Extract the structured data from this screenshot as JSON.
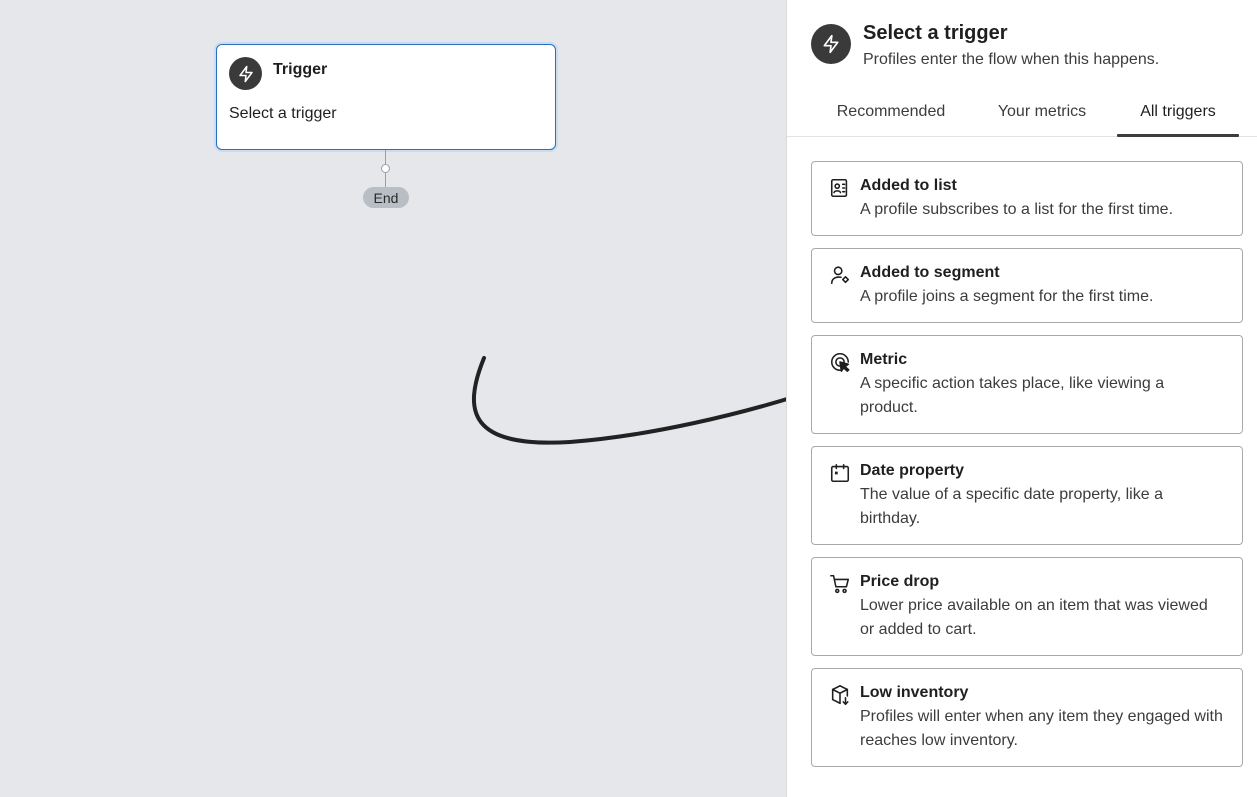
{
  "canvas": {
    "trigger_card": {
      "title": "Trigger",
      "subtitle": "Select a trigger",
      "icon": "lightning-icon"
    },
    "end_label": "End"
  },
  "panel": {
    "title": "Select a trigger",
    "subtitle": "Profiles enter the flow when this happens.",
    "icon": "lightning-icon",
    "tabs": [
      {
        "label": "Recommended",
        "active": false
      },
      {
        "label": "Your metrics",
        "active": false
      },
      {
        "label": "All triggers",
        "active": true
      }
    ],
    "options": [
      {
        "title": "Added to list",
        "description": "A profile subscribes to a list for the first time.",
        "icon": "contact-list-icon"
      },
      {
        "title": "Added to segment",
        "description": "A profile joins a segment for the first time.",
        "icon": "user-segment-icon"
      },
      {
        "title": "Metric",
        "description": "A specific action takes place, like viewing a product.",
        "icon": "cursor-target-icon"
      },
      {
        "title": "Date property",
        "description": "The value of a specific date property, like a birthday.",
        "icon": "calendar-icon"
      },
      {
        "title": "Price drop",
        "description": "Lower price available on an item that was viewed or added to cart.",
        "icon": "shopping-cart-icon"
      },
      {
        "title": "Low inventory",
        "description": "Profiles will enter when any item they engaged with reaches low inventory.",
        "icon": "box-down-icon"
      }
    ]
  },
  "colors": {
    "canvas_bg": "#e6e7ea",
    "selection_border": "#2e6fba",
    "badge_bg": "#3a3a3a",
    "annotation_arrow": "#222222"
  }
}
